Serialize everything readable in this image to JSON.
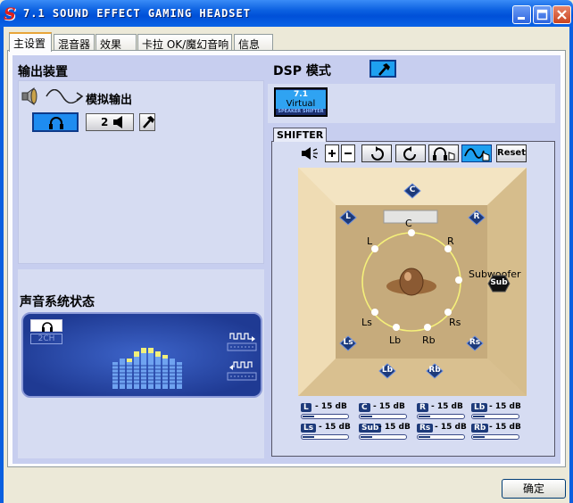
{
  "window": {
    "title": "7.1 SOUND EFFECT GAMING HEADSET",
    "app_icon_glyph": "S",
    "buttons": [
      "minimize",
      "maximize",
      "close"
    ]
  },
  "tabs": [
    {
      "label": "主设置",
      "active": true
    },
    {
      "label": "混音器",
      "active": false
    },
    {
      "label": "效果",
      "active": false
    },
    {
      "label": "卡拉 OK/魔幻音响",
      "active": false
    },
    {
      "label": "信息",
      "active": false
    }
  ],
  "output": {
    "heading": "输出装置",
    "mode_label": "模拟输出",
    "speaker_count": "2"
  },
  "system_status": {
    "heading": "声音系统状态",
    "channel_label": "2CH"
  },
  "dsp": {
    "heading": "DSP 模式",
    "virtual_badge_top": "7.1",
    "virtual_badge_mid": "Virtual",
    "virtual_badge_bottom": "SPEAKER SHIFTER"
  },
  "shifter": {
    "tab_label": "SHIFTER",
    "reset_label": "Reset",
    "room_labels": {
      "C": "C",
      "L": "L",
      "R": "R",
      "Ls": "Ls",
      "Rs": "Rs",
      "Lb": "Lb",
      "Rb": "Rb",
      "Subwoofer": "Subwoofer"
    },
    "speaker_badges": [
      "C",
      "L",
      "R",
      "Ls",
      "Rs",
      "Lb",
      "Rb",
      "Sub"
    ]
  },
  "levels": [
    {
      "channel": "L",
      "value": "- 15 dB",
      "fill": 0.25
    },
    {
      "channel": "C",
      "value": "- 15 dB",
      "fill": 0.25
    },
    {
      "channel": "R",
      "value": "- 15 dB",
      "fill": 0.25
    },
    {
      "channel": "Lb",
      "value": "- 15 dB",
      "fill": 0.25
    },
    {
      "channel": "Ls",
      "value": "- 15 dB",
      "fill": 0.25
    },
    {
      "channel": "Sub",
      "value": "- 15 dB",
      "fill": 0.25
    },
    {
      "channel": "Rs",
      "value": "- 15 dB",
      "fill": 0.25
    },
    {
      "channel": "Rb",
      "value": "- 15 dB",
      "fill": 0.25
    }
  ],
  "footer": {
    "ok_label": "确定"
  }
}
